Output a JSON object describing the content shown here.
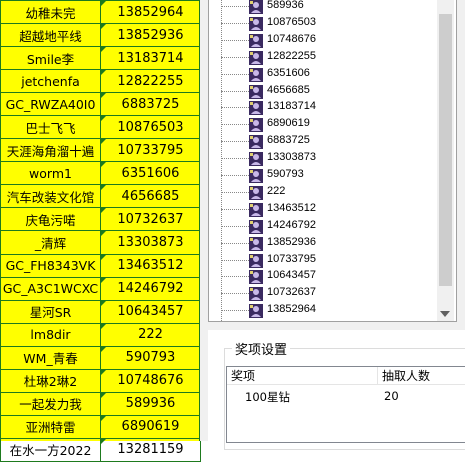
{
  "sheet": {
    "rows": [
      {
        "name": "幼稚未完",
        "id": "13852964"
      },
      {
        "name": "超越地平线",
        "id": "13852936"
      },
      {
        "name": "Smile李",
        "id": "13183714"
      },
      {
        "name": "jetchenfa",
        "id": "12822255"
      },
      {
        "name": "GC_RWZA40I0",
        "id": "6883725"
      },
      {
        "name": "巴士飞飞",
        "id": "10876503"
      },
      {
        "name": "天涯海角溜十遍",
        "id": "10733795"
      },
      {
        "name": "worm1",
        "id": "6351606"
      },
      {
        "name": "汽车改装文化馆",
        "id": "4656685"
      },
      {
        "name": "庆龟污喏",
        "id": "10732637"
      },
      {
        "name": "_清辉",
        "id": "13303873"
      },
      {
        "name": "GC_FH8343VK",
        "id": "13463512"
      },
      {
        "name": "GC_A3C1WCXC",
        "id": "14246792"
      },
      {
        "name": "星河SR",
        "id": "10643457"
      },
      {
        "name": "lm8dir",
        "id": "222"
      },
      {
        "name": "WM_青春",
        "id": "590793"
      },
      {
        "name": "杜琳2琳2",
        "id": "10748676"
      },
      {
        "name": "一起发力我",
        "id": "589936"
      },
      {
        "name": "亚洲特雷",
        "id": "6890619"
      },
      {
        "name": "在水一方2022",
        "id": "13281159"
      }
    ]
  },
  "tree": {
    "items": [
      "589936",
      "10876503",
      "10748676",
      "12822255",
      "6351606",
      "4656685",
      "13183714",
      "6890619",
      "6883725",
      "13303873",
      "590793",
      "222",
      "13463512",
      "14246792",
      "13852936",
      "10733795",
      "10643457",
      "10732637",
      "13852964",
      "13281159"
    ],
    "icon": "user-icon"
  },
  "prize_settings": {
    "title": "奖项设置",
    "columns": [
      "奖项",
      "抽取人数"
    ],
    "rows": [
      {
        "prize": "100星钻",
        "count": "20"
      }
    ]
  },
  "colors": {
    "sheet_fill": "#ffff00",
    "grid": "#1e7a1e"
  }
}
